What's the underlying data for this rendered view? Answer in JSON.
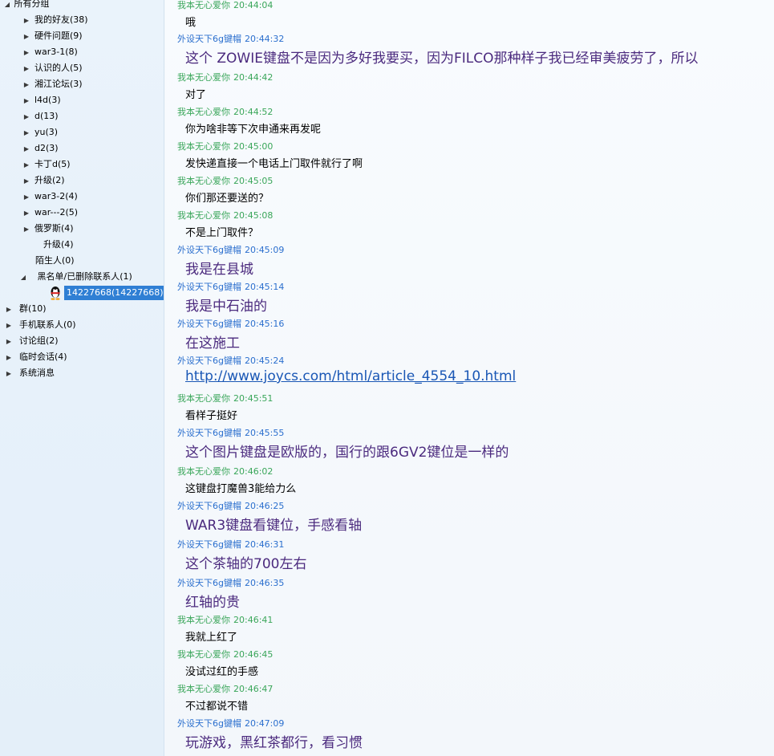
{
  "sidebar": {
    "top_group": "所有分组",
    "friend_groups": [
      "我的好友(38)",
      "硬件问题(9)",
      "war3-1(8)",
      "认识的人(5)",
      "湘江论坛(3)",
      "l4d(3)",
      "d(13)",
      "yu(3)",
      "d2(3)",
      "卡丁d(5)",
      "升级(2)",
      "war3-2(4)",
      "war---2(5)",
      "俄罗斯(4)"
    ],
    "sub_group": "升级(4)",
    "strangers": "陌生人(0)",
    "blacklist": "黑名单/已删除联系人(1)",
    "selected_contact": "14227668(14227668)",
    "other_groups": [
      "群(10)",
      "手机联系人(0)",
      "讨论组(2)",
      "临时会话(4)",
      "系统消息"
    ]
  },
  "chat": {
    "messages": [
      {
        "sender": "我本无心爱你",
        "time": "20:44:04",
        "text": "哦",
        "me": true
      },
      {
        "sender": "外设天下6g键帽",
        "time": "20:44:32",
        "text": "这个 ZOWIE键盘不是因为多好我要买，因为FILCO那种样子我已经审美疲劳了，所以",
        "me": false
      },
      {
        "sender": "我本无心爱你",
        "time": "20:44:42",
        "text": "对了",
        "me": true
      },
      {
        "sender": "我本无心爱你",
        "time": "20:44:52",
        "text": "你为啥非等下次申通来再发呢",
        "me": true
      },
      {
        "sender": "我本无心爱你",
        "time": "20:45:00",
        "text": "发快递直接一个电话上门取件就行了啊",
        "me": true
      },
      {
        "sender": "我本无心爱你",
        "time": "20:45:05",
        "text": "你们那还要送的？",
        "me": true
      },
      {
        "sender": "我本无心爱你",
        "time": "20:45:08",
        "text": "不是上门取件？",
        "me": true
      },
      {
        "sender": "外设天下6g键帽",
        "time": "20:45:09",
        "text": "我是在县城",
        "me": false
      },
      {
        "sender": "外设天下6g键帽",
        "time": "20:45:14",
        "text": "我是中石油的",
        "me": false
      },
      {
        "sender": "外设天下6g键帽",
        "time": "20:45:16",
        "text": "在这施工",
        "me": false
      },
      {
        "sender": "外设天下6g键帽",
        "time": "20:45:24",
        "text": "http://www.joycs.com/html/article_4554_10.html",
        "me": false,
        "link": true
      },
      {
        "sender": "我本无心爱你",
        "time": "20:45:51",
        "text": "看样子挺好",
        "me": true
      },
      {
        "sender": "外设天下6g键帽",
        "time": "20:45:55",
        "text": "这个图片键盘是欧版的，国行的跟6GV2键位是一样的",
        "me": false
      },
      {
        "sender": "我本无心爱你",
        "time": "20:46:02",
        "text": "这键盘打魔兽3能给力么",
        "me": true
      },
      {
        "sender": "外设天下6g键帽",
        "time": "20:46:25",
        "text": "WAR3键盘看键位，手感看轴",
        "me": false
      },
      {
        "sender": "外设天下6g键帽",
        "time": "20:46:31",
        "text": "这个茶轴的700左右",
        "me": false
      },
      {
        "sender": "外设天下6g键帽",
        "time": "20:46:35",
        "text": "红轴的贵",
        "me": false
      },
      {
        "sender": "我本无心爱你",
        "time": "20:46:41",
        "text": "我就上红了",
        "me": true
      },
      {
        "sender": "我本无心爱你",
        "time": "20:46:45",
        "text": "没试过红的手感",
        "me": true
      },
      {
        "sender": "我本无心爱你",
        "time": "20:46:47",
        "text": "不过都说不错",
        "me": true
      },
      {
        "sender": "外设天下6g键帽",
        "time": "20:47:09",
        "text": "玩游戏，黑红茶都行，看习惯",
        "me": false
      }
    ]
  }
}
